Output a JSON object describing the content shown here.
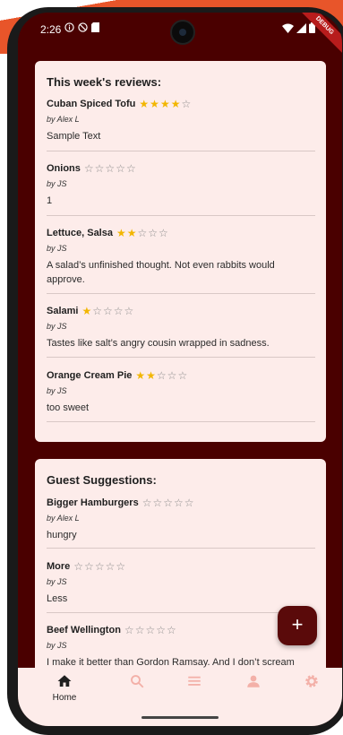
{
  "status_bar": {
    "time": "2:26"
  },
  "debug_banner": "DEBUG",
  "reviews_card": {
    "title": "This week's reviews:",
    "items": [
      {
        "name": "Cuban Spiced Tofu",
        "rating": 4,
        "by": "by Alex L",
        "text": "Sample Text"
      },
      {
        "name": "Onions",
        "rating": 0,
        "by": "by JS",
        "text": "1"
      },
      {
        "name": "Lettuce, Salsa",
        "rating": 2,
        "by": "by JS",
        "text": "A salad’s unfinished thought. Not even rabbits would approve."
      },
      {
        "name": "Salami",
        "rating": 1,
        "by": "by JS",
        "text": "Tastes like salt’s angry cousin wrapped in sadness."
      },
      {
        "name": "Orange Cream Pie",
        "rating": 2,
        "by": "by JS",
        "text": "too sweet"
      }
    ]
  },
  "suggestions_card": {
    "title": "Guest Suggestions:",
    "items": [
      {
        "name": "Bigger Hamburgers",
        "rating": 0,
        "by": "by Alex L",
        "text": "hungry"
      },
      {
        "name": "More",
        "rating": 0,
        "by": "by JS",
        "text": "Less"
      },
      {
        "name": "Beef Wellington",
        "rating": 0,
        "by": "by JS",
        "text": "I make it better than Gordon Ramsay. And I don’t scream"
      }
    ]
  },
  "fab": {
    "label": "+"
  },
  "bottom_nav": {
    "items": [
      {
        "label": "Home",
        "icon": "home-icon",
        "active": true
      },
      {
        "icon": "search-icon"
      },
      {
        "icon": "list-icon"
      },
      {
        "icon": "person-icon"
      },
      {
        "icon": "settings-icon"
      }
    ]
  },
  "colors": {
    "app_background": "#4a0000",
    "card_background": "#fdecea",
    "star_filled": "#f2b600",
    "star_empty": "#8c8c8c",
    "fab": "#5a0a0a",
    "nav_inactive_icon": "#f3b0a8"
  }
}
